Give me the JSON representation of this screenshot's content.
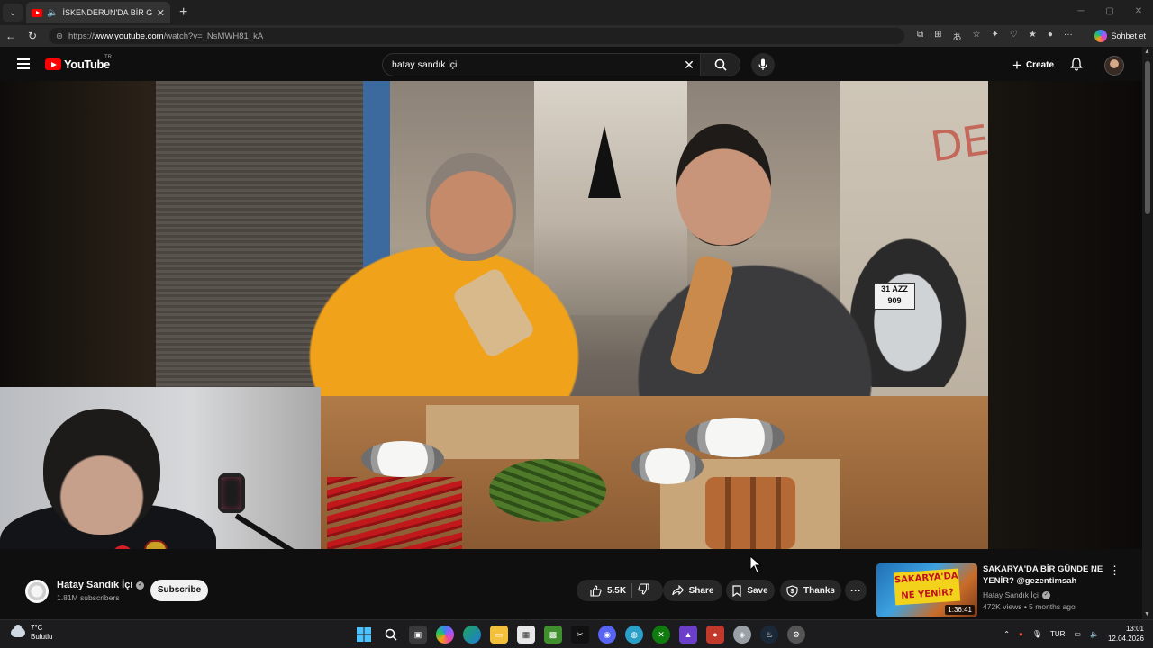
{
  "browser": {
    "tab_title": "İSKENDERUN'DA BİR GÜNDE",
    "url_prefix": "https://",
    "url_host": "www.youtube.com",
    "url_path": "/watch?v=_NsMWH81_kA",
    "copilot_label": "Sohbet et"
  },
  "masthead": {
    "logo_text": "YouTube",
    "region": "TR",
    "search_value": "hatay sandık içi",
    "create_label": "Create"
  },
  "video_frame": {
    "graffiti": "DER",
    "plate_line1": "31 AZZ",
    "plate_line2": "909"
  },
  "channel": {
    "name": "Hatay Sandık İçi",
    "subscribers": "1.81M subscribers",
    "subscribe_label": "Subscribe"
  },
  "actions": {
    "likes": "5.5K",
    "share_label": "Share",
    "save_label": "Save",
    "thanks_label": "Thanks"
  },
  "suggested": {
    "title": "SAKARYA'DA BİR GÜNDE NE YENİR? @gezentimsah",
    "channel": "Hatay Sandık İçi",
    "meta": "472K views • 5 months ago",
    "duration": "1:36:41",
    "thumb_text": "SAKARYA'DA NE YENİR?"
  },
  "taskbar": {
    "temperature": "7°C",
    "condition": "Bulutlu",
    "language": "TUR",
    "time": "13:01",
    "date": "12.04.2026"
  },
  "colors": {
    "youtube_red": "#ff0000",
    "background": "#0f0f0f",
    "pill": "#272727"
  }
}
